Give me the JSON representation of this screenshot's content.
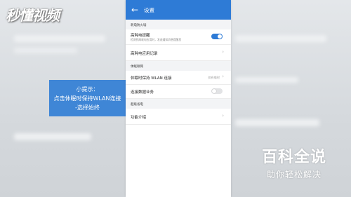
{
  "watermark": {
    "logo_text": "秒懂视频"
  },
  "tip": {
    "title": "小提示：",
    "line1": "点击休眠时保持WLAN连接",
    "line2": "-选择始终"
  },
  "screen": {
    "title": "设置",
    "sections": [
      {
        "label": "耗电防火墙",
        "rows": [
          {
            "main": "高耗电提醒",
            "sub": "检测到高耗电应用时，发送通知消息提醒您",
            "control": "toggle-on"
          },
          {
            "main": "高耗电应用记录",
            "control": "chevron"
          }
        ]
      },
      {
        "label": "休眠联网",
        "rows": [
          {
            "main": "休眠时保持 WLAN 连接",
            "value": "仅充电时",
            "control": "chevron"
          },
          {
            "main": "连接数据业务",
            "control": "toggle-off"
          }
        ]
      },
      {
        "label": "超级省电",
        "rows": [
          {
            "main": "功能介绍",
            "control": "chevron"
          }
        ]
      }
    ],
    "accent_color": "#2e7bd6"
  },
  "brand": {
    "main": "百科全说",
    "sub": "助你轻松解决"
  }
}
